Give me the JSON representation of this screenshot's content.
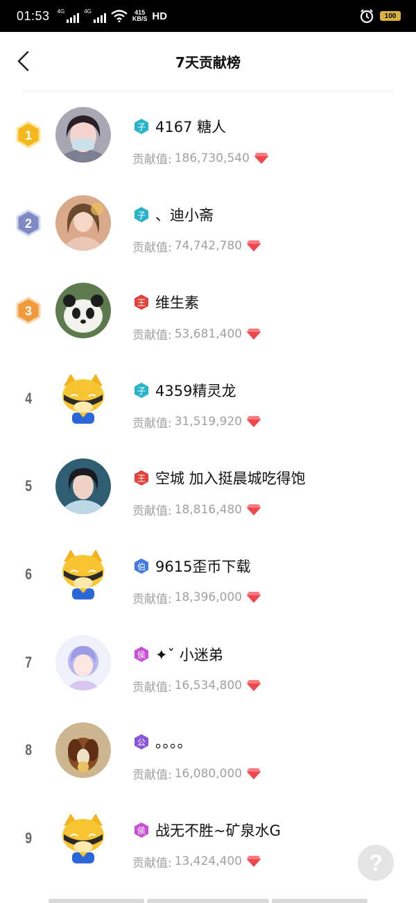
{
  "status_bar": {
    "time": "01:53",
    "net1": "4G",
    "net2": "4G",
    "speed_value": "415",
    "speed_unit": "KB/S",
    "hd": "HD",
    "battery": "100"
  },
  "header": {
    "title": "7天贡献榜"
  },
  "list": {
    "items": [
      {
        "rank": "1",
        "level": "子",
        "level_color": "#27b4c9",
        "name": "4167 糖人",
        "label": "贡献值:",
        "value": "186,730,540"
      },
      {
        "rank": "2",
        "level": "子",
        "level_color": "#27b4c9",
        "name": "、迪小斋",
        "label": "贡献值:",
        "value": "74,742,780"
      },
      {
        "rank": "3",
        "level": "王",
        "level_color": "#e0433b",
        "name": "维生素",
        "label": "贡献值:",
        "value": "53,681,400"
      },
      {
        "rank": "4",
        "level": "子",
        "level_color": "#27b4c9",
        "name": "4359精灵龙",
        "label": "贡献值:",
        "value": "31,519,920"
      },
      {
        "rank": "5",
        "level": "王",
        "level_color": "#e0433b",
        "name": "空城 加入挺晨城吃得饱",
        "label": "贡献值:",
        "value": "18,816,480"
      },
      {
        "rank": "6",
        "level": "伯",
        "level_color": "#3f7be0",
        "name": "9615歪币下载",
        "label": "贡献值:",
        "value": "18,396,000"
      },
      {
        "rank": "7",
        "level": "侯",
        "level_color": "#c94fd6",
        "name": "✦ˇ 小迷弟",
        "label": "贡献值:",
        "value": "16,534,800"
      },
      {
        "rank": "8",
        "level": "公",
        "level_color": "#8a56d8",
        "name": "。。。。",
        "label": "贡献值:",
        "value": "16,080,000"
      },
      {
        "rank": "9",
        "level": "侯",
        "level_color": "#c94fd6",
        "name": "战无不胜~矿泉水G",
        "label": "贡献值:",
        "value": "13,424,400"
      }
    ]
  },
  "help": {
    "label": "?"
  },
  "colors": {
    "diamond": "#f0474f",
    "gold": "#f5b81c",
    "silver": "#7f89c4",
    "bronze": "#f09a3c"
  }
}
